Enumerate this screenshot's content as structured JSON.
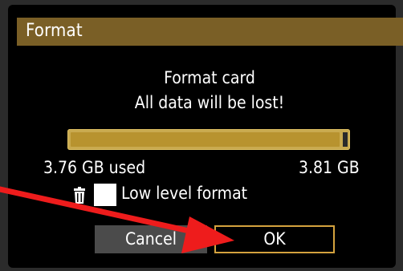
{
  "dialog": {
    "title": "Format",
    "message_line1": "Format card",
    "message_line2": "All data will be lost!",
    "used_label": "3.76 GB used",
    "total_label": "3.81 GB",
    "used_fraction": 0.987,
    "low_level_format_label": "Low level format",
    "low_level_format_checked": false,
    "cancel_label": "Cancel",
    "ok_label": "OK"
  },
  "colors": {
    "title_bar": "#7a5f26",
    "usage_bar": "#c9aa4f",
    "usage_fill": "#b8932f",
    "selected_border": "#d4a23e",
    "cancel_button": "#4b4b4b",
    "annotation_arrow": "#ee1c1c"
  },
  "icons": {
    "erase": "trash-icon",
    "annotation": "red-arrow"
  }
}
